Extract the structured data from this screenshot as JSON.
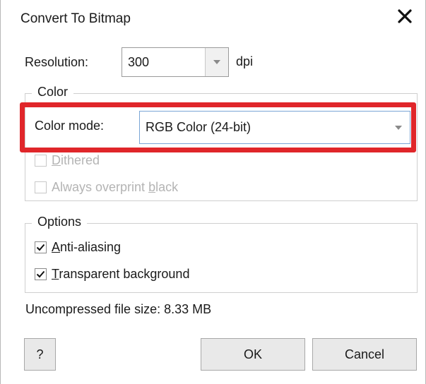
{
  "dialog": {
    "title": "Convert To Bitmap",
    "close_glyph": "✕"
  },
  "resolution": {
    "label_prefix": "Resolution:",
    "value": "300",
    "unit": "dpi"
  },
  "color_group": {
    "legend": "Color",
    "mode_label": "Color mode:",
    "mode_value": "RGB Color (24-bit)",
    "dithered": {
      "pre": "",
      "underlined": "D",
      "post": "ithered",
      "checked": false,
      "enabled": false
    },
    "overprint": {
      "pre": "Always overprint ",
      "underlined": "b",
      "post": "lack",
      "checked": false,
      "enabled": false
    },
    "highlight_color": "#e0262a"
  },
  "options_group": {
    "legend": "Options",
    "anti_aliasing": {
      "pre": "",
      "underlined": "A",
      "post": "nti-aliasing",
      "checked": true
    },
    "transparent_bg": {
      "pre": "",
      "underlined": "T",
      "post": "ransparent background",
      "checked": true
    }
  },
  "file_size": "Uncompressed file size: 8.33 MB",
  "buttons": {
    "help": "?",
    "ok": "OK",
    "cancel": "Cancel"
  }
}
